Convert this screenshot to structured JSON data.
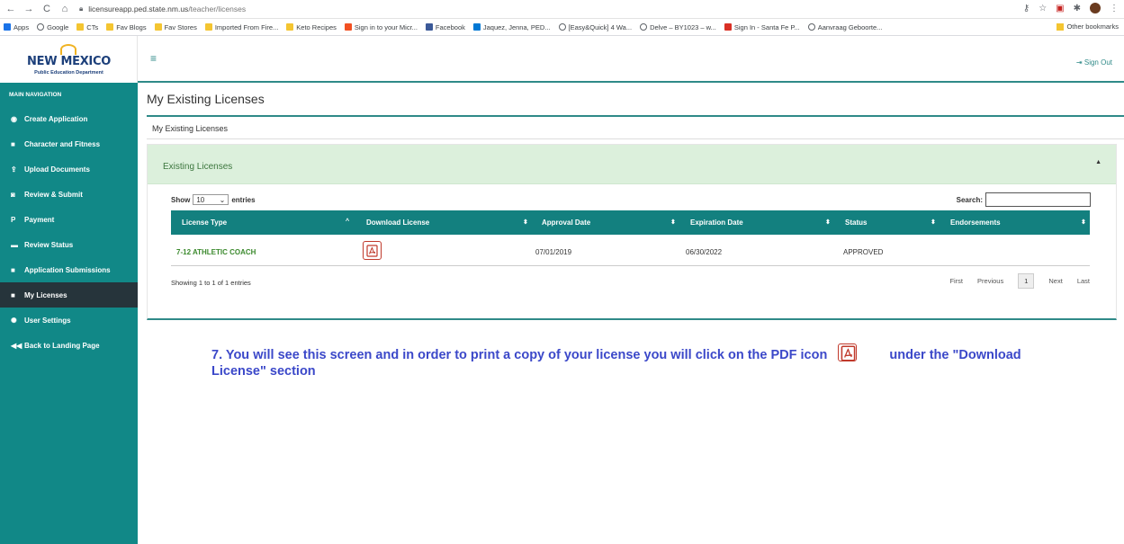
{
  "browser": {
    "url_host": "licensureapp.ped.state.nm.us",
    "url_path": "/teacher/licenses",
    "bookmarks": [
      {
        "label": "Apps",
        "icon": "grid"
      },
      {
        "label": "Google",
        "icon": "globe"
      },
      {
        "label": "CTs",
        "icon": "folder"
      },
      {
        "label": "Fav Blogs",
        "icon": "folder"
      },
      {
        "label": "Fav Stores",
        "icon": "folder"
      },
      {
        "label": "Imported From Fire...",
        "icon": "folder"
      },
      {
        "label": "Keto Recipes",
        "icon": "folder"
      },
      {
        "label": "Sign in to your Micr...",
        "icon": "win"
      },
      {
        "label": "Facebook",
        "icon": "fb"
      },
      {
        "label": "Jaquez, Jenna, PED...",
        "icon": "ms"
      },
      {
        "label": "[Easy&Quick] 4 Wa...",
        "icon": "globe"
      },
      {
        "label": "Delve – BY1023 – w...",
        "icon": "globe"
      },
      {
        "label": "Sign In - Santa Fe P...",
        "icon": "red"
      },
      {
        "label": "Aanvraag Geboorte...",
        "icon": "globe"
      }
    ],
    "other_bookmarks": "Other bookmarks"
  },
  "header": {
    "logo_name": "NEW MEXICO",
    "logo_sub": "Public Education Department",
    "sign_out": "Sign Out"
  },
  "sidebar": {
    "heading": "MAIN NAVIGATION",
    "items": [
      {
        "label": "Create Application",
        "icon": "globe-icon",
        "glyph": "◉"
      },
      {
        "label": "Character and Fitness",
        "icon": "folder-icon",
        "glyph": "■"
      },
      {
        "label": "Upload Documents",
        "icon": "upload-icon",
        "glyph": "⇪"
      },
      {
        "label": "Review & Submit",
        "icon": "camera-icon",
        "glyph": "◙"
      },
      {
        "label": "Payment",
        "icon": "parking-icon",
        "glyph": "P"
      },
      {
        "label": "Review Status",
        "icon": "folder-open-icon",
        "glyph": "▬"
      },
      {
        "label": "Application Submissions",
        "icon": "folder-icon",
        "glyph": "■"
      },
      {
        "label": "My Licenses",
        "icon": "folder-icon",
        "glyph": "■"
      },
      {
        "label": "User Settings",
        "icon": "gear-icon",
        "glyph": "✺"
      },
      {
        "label": "Back to Landing Page",
        "icon": "back-icon",
        "glyph": "◀◀"
      }
    ]
  },
  "main": {
    "title": "My Existing Licenses",
    "crumb": "My Existing Licenses",
    "panel_title": "Existing Licenses",
    "show_label": "Show",
    "entries_label": "entries",
    "page_size": "10",
    "search_label": "Search:",
    "columns": [
      "License Type",
      "Download License",
      "Approval Date",
      "Expiration Date",
      "Status",
      "Endorsements"
    ],
    "rows": [
      {
        "license_type": "7-12 ATHLETIC COACH",
        "approval_date": "07/01/2019",
        "expiration_date": "06/30/2022",
        "status": "APPROVED",
        "endorsements": ""
      }
    ],
    "showing": "Showing 1 to 1 of 1 entries",
    "pager": {
      "first": "First",
      "previous": "Previous",
      "current": "1",
      "next": "Next",
      "last": "Last"
    }
  },
  "instruction": {
    "part1": "7. You will see this screen and in order to print a copy of your license you will click on the PDF icon",
    "part2": "under the \"Download License\" section"
  },
  "colors": {
    "teal": "#118887",
    "header_teal": "#13807f",
    "active_nav": "#26343b",
    "panel_green": "#dcf0dc",
    "note_blue": "#3b48c9",
    "pdf_red": "#c0392b"
  }
}
